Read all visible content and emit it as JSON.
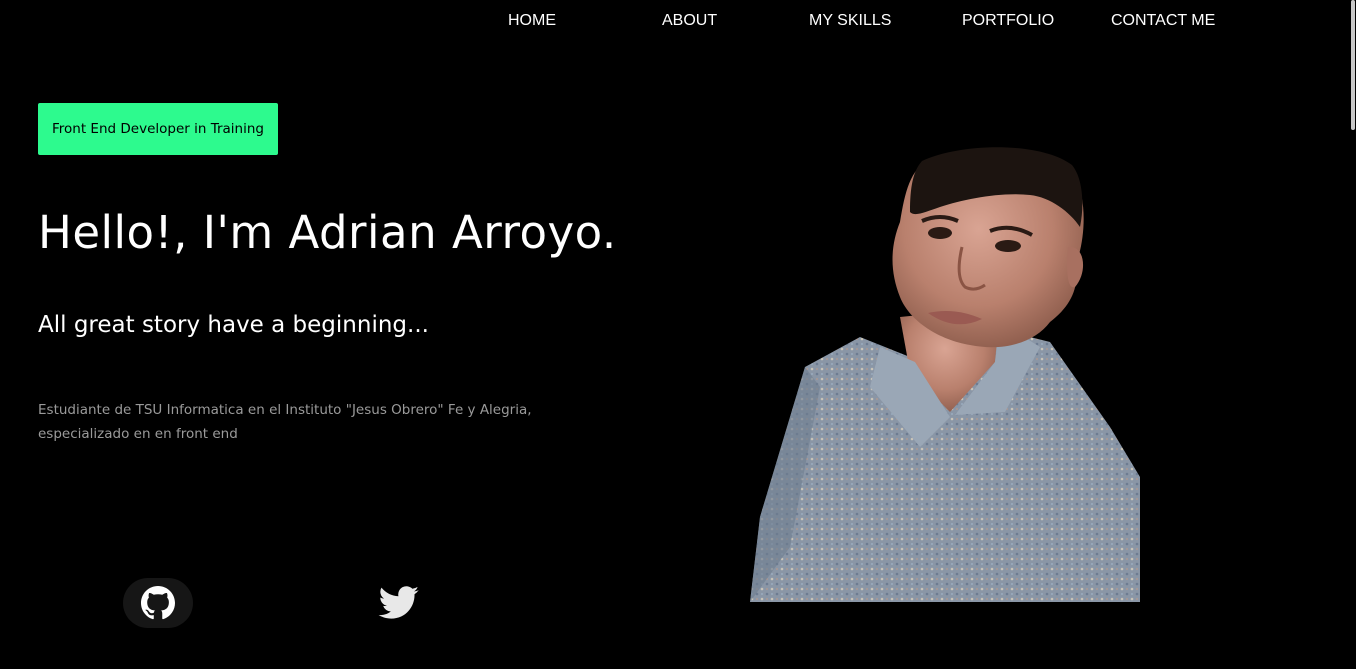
{
  "nav": {
    "items": [
      {
        "label": "HOME"
      },
      {
        "label": "ABOUT"
      },
      {
        "label": "MY SKILLS"
      },
      {
        "label": "PORTFOLIO"
      },
      {
        "label": "CONTACT ME"
      }
    ]
  },
  "hero": {
    "badge": "Front End Developer in Training",
    "headline": "Hello!, I'm Adrian Arroyo.",
    "tagline": "All great story have a beginning...",
    "description_line1": "Estudiante de TSU Informatica en el Instituto \"Jesus Obrero\" Fe y Alegria,",
    "description_line2": "especializado en en front end"
  },
  "social": {
    "github_icon": "github-icon",
    "twitter_icon": "twitter-icon"
  },
  "colors": {
    "background": "#000000",
    "accent": "#2dfa8e",
    "text": "#ffffff",
    "muted": "#9a9a9a"
  }
}
